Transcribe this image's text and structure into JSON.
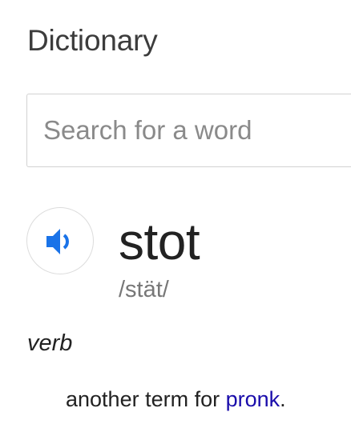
{
  "header": {
    "title": "Dictionary"
  },
  "search": {
    "placeholder": "Search for a word",
    "value": ""
  },
  "entry": {
    "audio_icon": "speaker-volume-icon",
    "word": "stot",
    "phonetic": "/stät/",
    "part_of_speech": "verb",
    "definition_prefix": "another term for ",
    "definition_link": "pronk",
    "definition_suffix": "."
  },
  "colors": {
    "accent": "#1a73e8",
    "link": "#1a0dab",
    "muted_text": "#777777",
    "placeholder": "#8a8a8a",
    "border": "#d2d2d2"
  }
}
